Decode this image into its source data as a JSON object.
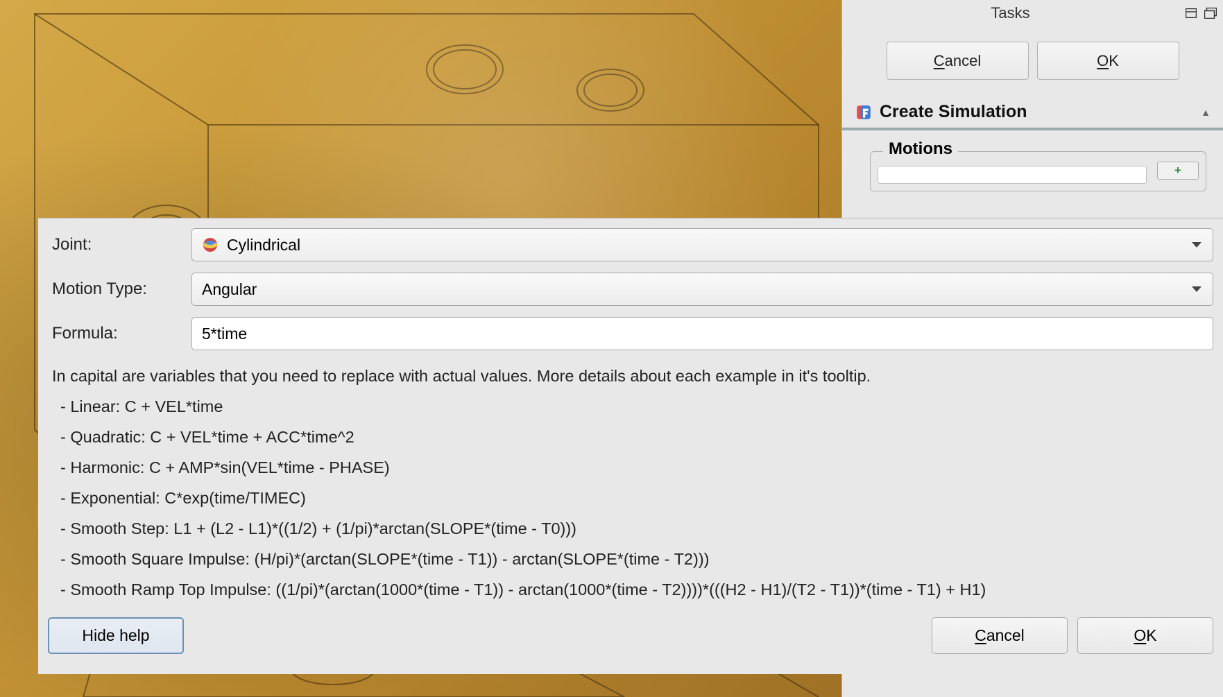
{
  "tasks": {
    "title": "Tasks",
    "cancel_label_pre": "",
    "cancel_u": "C",
    "cancel_rest": "ancel",
    "ok_label_pre": "",
    "ok_u": "O",
    "ok_rest": "K"
  },
  "section": {
    "title": "Create Simulation"
  },
  "motions": {
    "legend": "Motions"
  },
  "dialog": {
    "joint_label": "Joint:",
    "joint_value": "Cylindrical",
    "motion_type_label": "Motion Type:",
    "motion_type_value": "Angular",
    "formula_label": "Formula:",
    "formula_value": "5*time",
    "help_intro": "In capital are variables that you need to replace with actual values. More details about each example in it's tooltip.",
    "help_linear": " - Linear: C + VEL*time",
    "help_quadratic": " - Quadratic: C + VEL*time + ACC*time^2",
    "help_harmonic": " - Harmonic: C + AMP*sin(VEL*time - PHASE)",
    "help_exponential": " - Exponential: C*exp(time/TIMEC)",
    "help_smoothstep": " - Smooth Step: L1 + (L2 - L1)*((1/2) + (1/pi)*arctan(SLOPE*(time - T0)))",
    "help_smoothsquare": " - Smooth Square Impulse: (H/pi)*(arctan(SLOPE*(time - T1)) - arctan(SLOPE*(time - T2)))",
    "help_smoothramp": " - Smooth Ramp Top Impulse: ((1/pi)*(arctan(1000*(time - T1)) - arctan(1000*(time - T2))))*(((H2 - H1)/(T2 - T1))*(time - T1) + H1)",
    "hide_help_label": "Hide help",
    "cancel_u": "C",
    "cancel_rest": "ancel",
    "ok_u": "O",
    "ok_rest": "K"
  }
}
